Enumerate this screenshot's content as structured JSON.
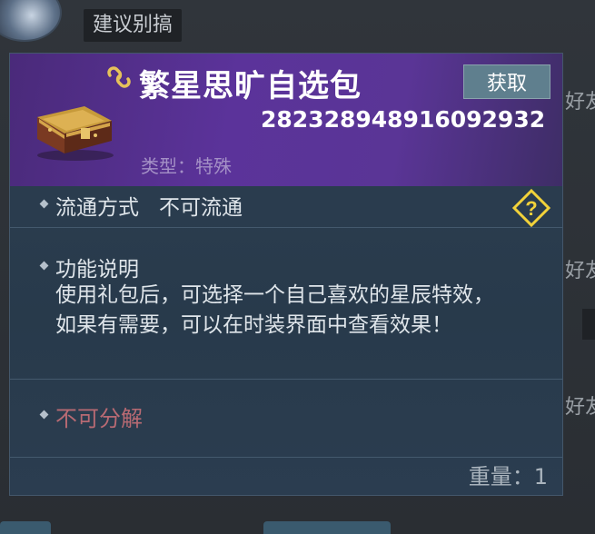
{
  "chat": {
    "top_message": "建议别搞",
    "side_snippets": [
      "好友",
      "好友",
      "好友"
    ]
  },
  "item": {
    "name": "繁星思旷自选包",
    "id_number": "282328948916092932",
    "type_line": "类型：特殊",
    "get_button_label": "获取",
    "circulation_label": "流通方式",
    "circulation_value": "不可流通",
    "function_title": "功能说明",
    "function_desc": "使用礼包后，可选择一个自己喜欢的星辰特效，如果有需要，可以在时装界面中查看效果！",
    "decompose_text": "不可分解",
    "weight_text": "重量：1"
  },
  "colors": {
    "header_purple": "#5b339a",
    "panel_bg": "#2d3f52",
    "decompose_red": "#b86a73",
    "help_yellow": "#f2d23a",
    "button_bg": "#5f7f8e"
  },
  "icons": [
    "link-chain-icon",
    "treasure-chest-icon",
    "help-question-icon",
    "diamond-bullet-icon"
  ]
}
